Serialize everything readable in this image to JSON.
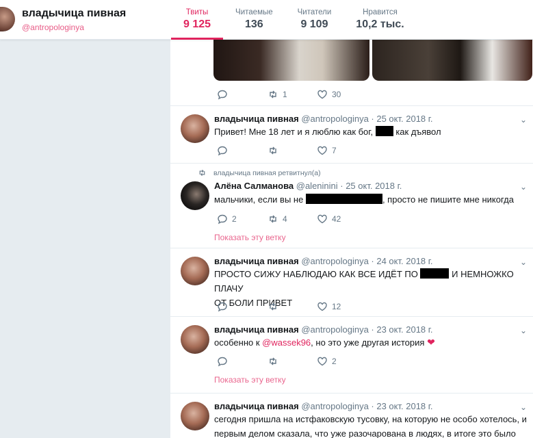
{
  "profile": {
    "name": "владычица пивная",
    "handle": "@antropologinya"
  },
  "stats": [
    {
      "label": "Твиты",
      "value": "9 125"
    },
    {
      "label": "Читаемые",
      "value": "136"
    },
    {
      "label": "Читатели",
      "value": "9 109"
    },
    {
      "label": "Нравится",
      "value": "10,2 тыс."
    }
  ],
  "tweets": [
    {
      "replies": "",
      "retweets": "1",
      "likes": "30"
    },
    {
      "name": "владычица пивная",
      "meta": "@antropologinya · 25 окт. 2018 г.",
      "text_a": "Привет! Мне 18 лет и я люблю как бог,",
      "text_b": "как дъявол",
      "replies": "",
      "retweets": "",
      "likes": "7"
    },
    {
      "retweeted_by": "владычица пивная ретвитнул(а)",
      "name": "Алёна Салманова",
      "meta": "@aleninini · 25 окт. 2018 г.",
      "text_a": "мальчики, если вы не",
      "text_b": ", просто не пишите мне никогда",
      "replies": "2",
      "retweets": "4",
      "likes": "42",
      "show_thread": "Показать эту ветку"
    },
    {
      "name": "владычица пивная",
      "meta": "@antropologinya · 24 окт. 2018 г.",
      "text_a": "ПРОСТО СИЖУ НАБЛЮДАЮ КАК ВСЕ ИДЁТ ПО",
      "text_b": "И НЕМНОЖКО ПЛАЧУ",
      "text_c": "ОТ БОЛИ ПРИВЕТ",
      "replies": "",
      "retweets": "",
      "likes": "12"
    },
    {
      "name": "владычица пивная",
      "meta": "@antropologinya · 23 окт. 2018 г.",
      "text_a": "особенно к",
      "mention": "@wassek96",
      "text_b": ", но это уже другая история",
      "replies": "",
      "retweets": "",
      "likes": "2",
      "show_thread": "Показать эту ветку"
    },
    {
      "name": "владычица пивная",
      "meta": "@antropologinya · 23 окт. 2018 г.",
      "text_a": "сегодня пришла на истфаковскую тусовку, на которую не особо хотелось, и",
      "text_b": "первым делом сказала, что уже разочарована в людях, в итоге это было"
    }
  ],
  "colors": {
    "accent": "#e0245e",
    "muted": "#657786",
    "panel": "#e6ecf0"
  },
  "icons": [
    "reply-icon",
    "retweet-icon",
    "like-icon",
    "chevron-down-icon",
    "heart-emoji-icon"
  ]
}
